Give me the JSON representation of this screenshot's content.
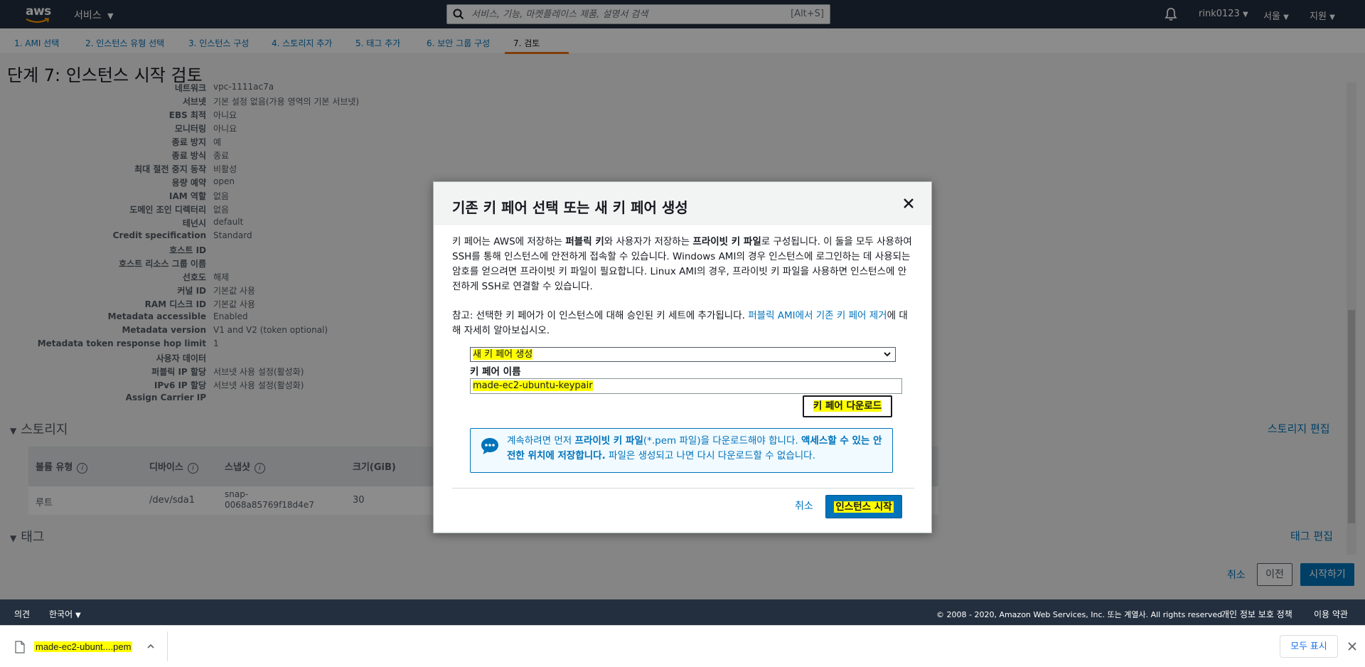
{
  "topnav": {
    "logo_text": "aws",
    "services_label": "서비스",
    "search_placeholder": "서비스, 기능, 마켓플레이스 제품, 설명서 검색",
    "search_shortcut": "[Alt+S]",
    "user": "rink0123",
    "region": "서울",
    "support": "지원"
  },
  "wizard_tabs": [
    {
      "label": "1. AMI 선택"
    },
    {
      "label": "2. 인스턴스 유형 선택"
    },
    {
      "label": "3. 인스턴스 구성"
    },
    {
      "label": "4. 스토리지 추가"
    },
    {
      "label": "5. 태그 추가"
    },
    {
      "label": "6. 보안 그룹 구성"
    },
    {
      "label": "7. 검토"
    }
  ],
  "page_title": "단계 7: 인스턴스 시작 검토",
  "details": [
    {
      "k": "네트워크",
      "v": "vpc-1111ac7a"
    },
    {
      "k": "서브넷",
      "v": "기본 설정 없음(가용 영역의 기본 서브넷)"
    },
    {
      "k": "EBS 최적",
      "v": "아니요"
    },
    {
      "k": "모니터링",
      "v": "아니요"
    },
    {
      "k": "종료 방지",
      "v": "예"
    },
    {
      "k": "종료 방식",
      "v": "종료"
    },
    {
      "k": "최대 절전 중지 동작",
      "v": "비활성"
    },
    {
      "k": "용량 예약",
      "v": "open"
    },
    {
      "k": "IAM 역할",
      "v": "없음"
    },
    {
      "k": "도메인 조인 디렉터리",
      "v": "없음"
    },
    {
      "k": "테넌시",
      "v": "default"
    },
    {
      "k": "Credit specification",
      "v": "Standard"
    },
    {
      "k": "호스트 ID",
      "v": ""
    },
    {
      "k": "호스트 리소스 그룹 이름",
      "v": ""
    },
    {
      "k": "선호도",
      "v": "해제"
    },
    {
      "k": "커널 ID",
      "v": "기본값 사용"
    },
    {
      "k": "RAM 디스크 ID",
      "v": "기본값 사용"
    },
    {
      "k": "Metadata accessible",
      "v": "Enabled"
    },
    {
      "k": "Metadata version",
      "v": "V1 and V2 (token optional)"
    },
    {
      "k": "Metadata token response hop limit",
      "v": "1"
    },
    {
      "k": "사용자 데이터",
      "v": ""
    },
    {
      "k": "퍼블릭 IP 할당",
      "v": "서브넷 사용 설정(활성화)"
    },
    {
      "k": "IPv6 IP 할당",
      "v": "서브넷 사용 설정(활성화)"
    },
    {
      "k": "Assign Carrier IP",
      "v": ""
    }
  ],
  "storage": {
    "title": "스토리지",
    "edit": "스토리지 편집",
    "headers": [
      "볼륨 유형",
      "디바이스",
      "스냅샷",
      "크기(GiB)"
    ],
    "row": {
      "type": "루트",
      "device": "/dev/sda1",
      "snapshot_line1": "snap-",
      "snapshot_line2": "0068a85769f18d4e7",
      "size": "30"
    }
  },
  "tags": {
    "title": "태그",
    "edit": "태그 편집"
  },
  "bottom_actions": {
    "cancel": "취소",
    "prev": "이전",
    "launch": "시작하기"
  },
  "modal": {
    "title": "기존 키 페어 선택 또는 새 키 페어 생성",
    "desc_p1": "키 페어는 AWS에 저장하는 ",
    "desc_b1": "퍼블릭 키",
    "desc_p2": "와 사용자가 저장하는 ",
    "desc_b2": "프라이빗 키 파일",
    "desc_p3": "로 구성됩니다. 이 둘을 모두 사용하여 SSH를 통해 인스턴스에 안전하게 접속할 수 있습니다. Windows AMI의 경우 인스턴스에 로그인하는 데 사용되는 암호를 얻으려면 프라이빗 키 파일이 필요합니다. Linux AMI의 경우, 프라이빗 키 파일을 사용하면 인스턴스에 안전하게 SSH로 연결할 수 있습니다.",
    "note_p1": "참고: 선택한 키 페어가 이 인스턴스에 대해 승인된 키 세트에 추가됩니다. ",
    "note_link": "퍼블릭 AMI에서 기존 키 페어 제거",
    "note_p2": "에 대해 자세히 알아보십시오.",
    "select_value": "새 키 페어 생성",
    "name_label": "키 페어 이름",
    "name_value": "made-ec2-ubuntu-keypair",
    "download_label": "키 페어 다운로드",
    "info_p1": "계속하려면 먼저 ",
    "info_b1": "프라이빗 키 파일",
    "info_p2": "(*.pem 파일)을 다운로드해야 합니다. ",
    "info_b2": "액세스할 수 있는 안전한 위치에 저장합니다.",
    "info_p3": " 파일은 생성되고 나면 다시 다운로드할 수 없습니다.",
    "cancel": "취소",
    "launch": "인스턴스 시작"
  },
  "footer": {
    "feedback": "의견",
    "language": "한국어",
    "copyright": "© 2008 - 2020, Amazon Web Services, Inc. 또는 계열사. All rights reserved.",
    "privacy": "개인 정보 보호 정책",
    "terms": "이용 약관"
  },
  "download_bar": {
    "file_name": "made-ec2-ubunt....pem",
    "show_all": "모두 표시"
  }
}
